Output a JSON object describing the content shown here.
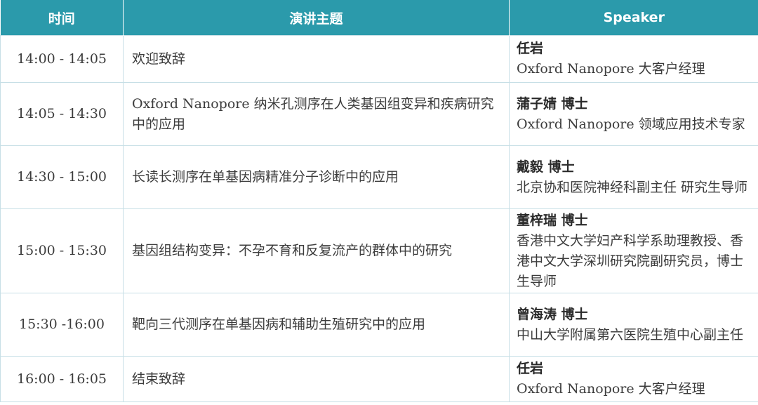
{
  "header": {
    "time": "时间",
    "topic": "演讲主题",
    "speaker": "Speaker"
  },
  "rows": [
    {
      "time": "14:00 - 14:05",
      "topic": "欢迎致辞",
      "speaker_name": "任岩",
      "speaker_title": "Oxford Nanopore 大客户经理"
    },
    {
      "time": "14:05 - 14:30",
      "topic": "Oxford Nanopore 纳米孔测序在人类基因组变异和疾病研究中的应用",
      "speaker_name": "蒲子婧 博士",
      "speaker_title": "Oxford Nanopore 领域应用技术专家"
    },
    {
      "time": "14:30 - 15:00",
      "topic": "长读长测序在单基因病精准分子诊断中的应用",
      "speaker_name": "戴毅  博士",
      "speaker_title": "北京协和医院神经科副主任 研究生导师"
    },
    {
      "time": "15:00 - 15:30",
      "topic": "基因组结构变异：不孕不育和反复流产的群体中的研究",
      "speaker_name": "董梓瑞 博士",
      "speaker_title": "香港中文大学妇产科学系助理教授、香港中文大学深圳研究院副研究员，博士生导师"
    },
    {
      "time": "15:30 -16:00",
      "topic": "靶向三代测序在单基因病和辅助生殖研究中的应用",
      "speaker_name": "曾海涛 博士",
      "speaker_title": "中山大学附属第六医院生殖中心副主任"
    },
    {
      "time": "16:00 - 16:05",
      "topic": "结束致辞",
      "speaker_name": "任岩",
      "speaker_title": "Oxford Nanopore 大客户经理"
    }
  ]
}
